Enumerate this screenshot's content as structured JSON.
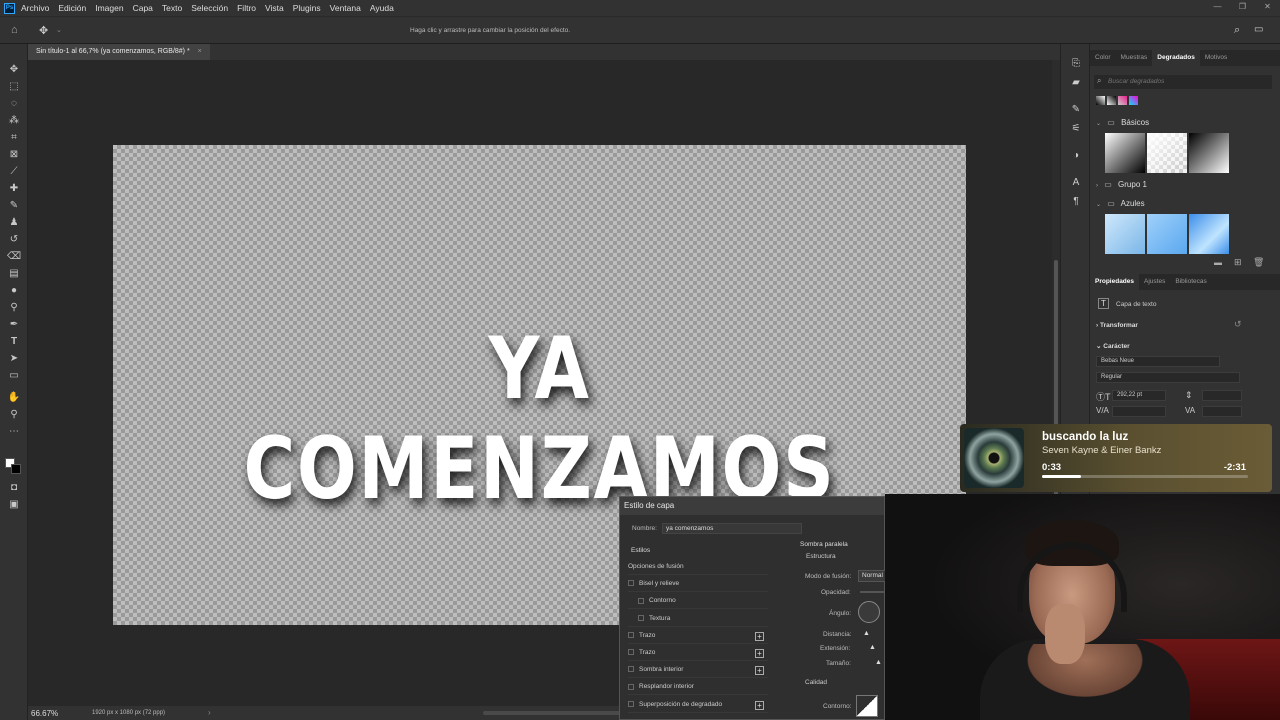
{
  "menu": [
    "Archivo",
    "Edición",
    "Imagen",
    "Capa",
    "Texto",
    "Selección",
    "Filtro",
    "Vista",
    "Plugins",
    "Ventana",
    "Ayuda"
  ],
  "app_logo_text": "Ps",
  "window_controls": [
    "—",
    "❐",
    "✕"
  ],
  "options_bar": {
    "hint": "Haga clic y arrastre para cambiar la posición del efecto."
  },
  "document": {
    "tab_title": "Sin título-1 al 66,7% (ya comenzamos, RGB/8#) *",
    "canvas_text": "YA COMENZAMOS",
    "zoom": "66.67%",
    "doc_info": "1920 px x 1080 px (72 ppp)"
  },
  "panels": {
    "top_tabs": [
      "Color",
      "Muestras",
      "Degradados",
      "Motivos"
    ],
    "active_top_tab": "Degradados",
    "search_placeholder": "Buscar degradados",
    "groups": [
      {
        "name": "Básicos",
        "expanded": true
      },
      {
        "name": "Grupo 1",
        "expanded": false
      },
      {
        "name": "Azules",
        "expanded": true
      }
    ],
    "bottom_tabs": [
      "Propiedades",
      "Ajustes",
      "Bibliotecas"
    ],
    "active_bottom_tab": "Propiedades",
    "layer_type": "Capa de texto",
    "section_transform": "Transformar",
    "section_character": "Carácter",
    "font_family": "Bebas Neue",
    "font_style": "Regular",
    "font_size": "292,22 pt"
  },
  "music": {
    "title": "buscando la luz",
    "artist": "Seven Kayne & Einer Bankz",
    "elapsed": "0:33",
    "remaining": "-2:31",
    "progress": 0.19
  },
  "layer_style_dialog": {
    "title": "Estilo de capa",
    "name_label": "Nombre:",
    "name_value": "ya comenzamos",
    "styles_header": "Estilos",
    "styles": [
      {
        "label": "Opciones de fusión",
        "checkbox": false,
        "plus": false,
        "indent": false
      },
      {
        "label": "Bisel y relieve",
        "checkbox": true,
        "plus": false,
        "indent": false
      },
      {
        "label": "Contorno",
        "checkbox": true,
        "plus": false,
        "indent": true
      },
      {
        "label": "Textura",
        "checkbox": true,
        "plus": false,
        "indent": true
      },
      {
        "label": "Trazo",
        "checkbox": true,
        "plus": true,
        "indent": false
      },
      {
        "label": "Trazo",
        "checkbox": true,
        "plus": true,
        "indent": false
      },
      {
        "label": "Sombra interior",
        "checkbox": true,
        "plus": true,
        "indent": false
      },
      {
        "label": "Resplandor interior",
        "checkbox": true,
        "plus": false,
        "indent": false
      },
      {
        "label": "Superposición de degradado",
        "checkbox": true,
        "plus": true,
        "indent": false
      }
    ],
    "effect_title": "Sombra paralela",
    "structure_label": "Estructura",
    "blend_mode_label": "Modo de fusión:",
    "blend_mode_value": "Normal",
    "opacity_label": "Opacidad:",
    "angle_label": "Ángulo:",
    "distance_label": "Distancia:",
    "spread_label": "Extensión:",
    "size_label": "Tamaño:",
    "quality_label": "Calidad",
    "contour_label": "Contorno:"
  }
}
